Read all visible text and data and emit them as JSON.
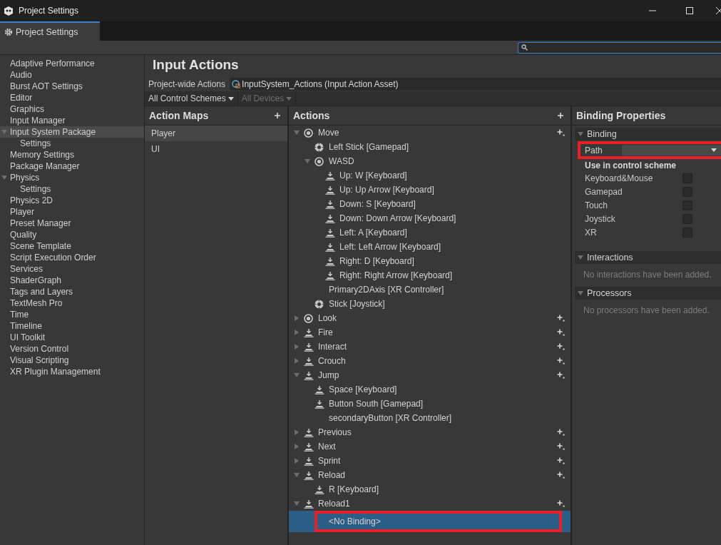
{
  "window": {
    "title": "Project Settings"
  },
  "tab": {
    "label": "Project Settings",
    "selected": true
  },
  "sidebar": {
    "items": [
      {
        "label": "Adaptive Performance",
        "selected": false
      },
      {
        "label": "Audio",
        "selected": false
      },
      {
        "label": "Burst AOT Settings",
        "selected": false
      },
      {
        "label": "Editor",
        "selected": false
      },
      {
        "label": "Graphics",
        "selected": false
      },
      {
        "label": "Input Manager",
        "selected": false
      },
      {
        "label": "Input System Package",
        "selected": true,
        "expanded": true,
        "children": [
          {
            "label": "Settings",
            "selected": false
          }
        ]
      },
      {
        "label": "Memory Settings",
        "selected": false
      },
      {
        "label": "Package Manager",
        "selected": false
      },
      {
        "label": "Physics",
        "selected": false,
        "expanded": true,
        "children": [
          {
            "label": "Settings",
            "selected": false
          }
        ]
      },
      {
        "label": "Physics 2D",
        "selected": false
      },
      {
        "label": "Player",
        "selected": false
      },
      {
        "label": "Preset Manager",
        "selected": false
      },
      {
        "label": "Quality",
        "selected": false
      },
      {
        "label": "Scene Template",
        "selected": false
      },
      {
        "label": "Script Execution Order",
        "selected": false
      },
      {
        "label": "Services",
        "selected": false
      },
      {
        "label": "ShaderGraph",
        "selected": false
      },
      {
        "label": "Tags and Layers",
        "selected": false
      },
      {
        "label": "TextMesh Pro",
        "selected": false
      },
      {
        "label": "Time",
        "selected": false
      },
      {
        "label": "Timeline",
        "selected": false
      },
      {
        "label": "UI Toolkit",
        "selected": false
      },
      {
        "label": "Version Control",
        "selected": false
      },
      {
        "label": "Visual Scripting",
        "selected": false
      },
      {
        "label": "XR Plugin Management",
        "selected": false
      }
    ]
  },
  "page": {
    "title": "Input Actions",
    "asset_label": "Project-wide Actions",
    "asset_value": "InputSystem_Actions (Input Action Asset)",
    "schemes": [
      {
        "label": "All Control Schemes",
        "disabled": false
      },
      {
        "label": "All Devices",
        "disabled": true
      }
    ]
  },
  "action_maps": {
    "title": "Action Maps",
    "items": [
      {
        "label": "Player",
        "selected": true
      },
      {
        "label": "UI",
        "selected": false
      }
    ]
  },
  "actions": {
    "title": "Actions",
    "items": [
      {
        "label": "Move",
        "kind": "vector",
        "expanded": true,
        "selected": false,
        "children": [
          {
            "label": "Left Stick [Gamepad]",
            "kind": "stick",
            "selected": false
          },
          {
            "label": "WASD",
            "kind": "vector",
            "expanded": true,
            "selected": false,
            "children": [
              {
                "label": "Up: W [Keyboard]",
                "kind": "button",
                "selected": false
              },
              {
                "label": "Up: Up Arrow [Keyboard]",
                "kind": "button",
                "selected": false
              },
              {
                "label": "Down: S [Keyboard]",
                "kind": "button",
                "selected": false
              },
              {
                "label": "Down: Down Arrow [Keyboard]",
                "kind": "button",
                "selected": false
              },
              {
                "label": "Left: A [Keyboard]",
                "kind": "button",
                "selected": false
              },
              {
                "label": "Left: Left Arrow [Keyboard]",
                "kind": "button",
                "selected": false
              },
              {
                "label": "Right: D [Keyboard]",
                "kind": "button",
                "selected": false
              },
              {
                "label": "Right: Right Arrow [Keyboard]",
                "kind": "button",
                "selected": false
              }
            ]
          },
          {
            "label": "Primary2DAxis [XR Controller]",
            "kind": "plain",
            "selected": false
          },
          {
            "label": "Stick [Joystick]",
            "kind": "stick",
            "selected": false
          }
        ]
      },
      {
        "label": "Look",
        "kind": "vector",
        "expanded": false,
        "selected": false
      },
      {
        "label": "Fire",
        "kind": "button",
        "expanded": false,
        "selected": false
      },
      {
        "label": "Interact",
        "kind": "button",
        "expanded": false,
        "selected": false
      },
      {
        "label": "Crouch",
        "kind": "button",
        "expanded": false,
        "selected": false
      },
      {
        "label": "Jump",
        "kind": "button",
        "expanded": true,
        "selected": false,
        "children": [
          {
            "label": "Space [Keyboard]",
            "kind": "button",
            "selected": false
          },
          {
            "label": "Button South [Gamepad]",
            "kind": "button",
            "selected": false
          },
          {
            "label": "secondaryButton [XR Controller]",
            "kind": "plain",
            "selected": false
          }
        ]
      },
      {
        "label": "Previous",
        "kind": "button",
        "expanded": false,
        "selected": false
      },
      {
        "label": "Next",
        "kind": "button",
        "expanded": false,
        "selected": false
      },
      {
        "label": "Sprint",
        "kind": "button",
        "expanded": false,
        "selected": false
      },
      {
        "label": "Reload",
        "kind": "button",
        "expanded": true,
        "selected": false,
        "children": [
          {
            "label": "R [Keyboard]",
            "kind": "button",
            "selected": false
          }
        ]
      },
      {
        "label": "Reload1",
        "kind": "button",
        "expanded": true,
        "selected": false,
        "children": [
          {
            "label": "<No Binding>",
            "kind": "plain",
            "selected": true,
            "highlighted": true
          }
        ]
      }
    ]
  },
  "binding_properties": {
    "title": "Binding Properties",
    "binding": {
      "title": "Binding",
      "expanded": true,
      "path_label": "Path",
      "path_highlighted": true,
      "scheme_title": "Use in control scheme",
      "schemes": [
        {
          "label": "Keyboard&Mouse",
          "checked": false
        },
        {
          "label": "Gamepad",
          "checked": false
        },
        {
          "label": "Touch",
          "checked": false
        },
        {
          "label": "Joystick",
          "checked": false
        },
        {
          "label": "XR",
          "checked": false
        }
      ]
    },
    "interactions": {
      "title": "Interactions",
      "expanded": true,
      "empty": "No interactions have been added."
    },
    "processors": {
      "title": "Processors",
      "expanded": true,
      "empty": "No processors have been added."
    }
  }
}
